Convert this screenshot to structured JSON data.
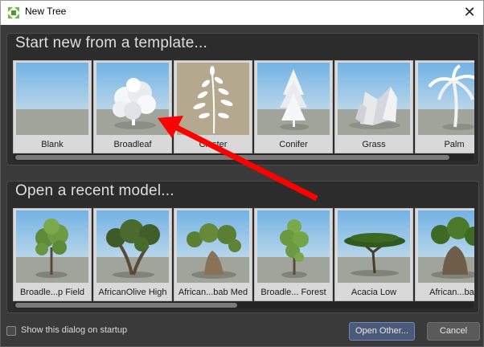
{
  "window": {
    "title": "New Tree",
    "close_glyph": "✕",
    "icon": "app-tree-icon"
  },
  "templates": {
    "heading": "Start new from a template...",
    "items": [
      {
        "label": "Blank",
        "icon": "blank-thumbnail"
      },
      {
        "label": "Broadleaf",
        "icon": "broadleaf-thumbnail"
      },
      {
        "label": "Cluster",
        "icon": "cluster-thumbnail"
      },
      {
        "label": "Conifer",
        "icon": "conifer-thumbnail"
      },
      {
        "label": "Grass",
        "icon": "grass-thumbnail"
      },
      {
        "label": "Palm",
        "icon": "palm-thumbnail"
      }
    ],
    "scroll_position": 0.0
  },
  "recent": {
    "heading": "Open a recent model...",
    "items": [
      {
        "label": "Broadle...p Field",
        "icon": "tree-thumbnail"
      },
      {
        "label": "AfricanOlive High",
        "icon": "tree-thumbnail"
      },
      {
        "label": "African...bab Med",
        "icon": "tree-thumbnail"
      },
      {
        "label": "Broadle... Forest",
        "icon": "tree-thumbnail"
      },
      {
        "label": "Acacia Low",
        "icon": "tree-thumbnail"
      },
      {
        "label": "African...bab",
        "icon": "tree-thumbnail"
      }
    ],
    "scroll_position": 0.0
  },
  "footer": {
    "startup_checkbox_label": "Show this dialog on startup",
    "startup_checked": false,
    "open_other_label": "Open Other...",
    "cancel_label": "Cancel"
  },
  "colors": {
    "annotation_arrow": "#ff0000",
    "sky_top": "#7bb8e6",
    "ground": "#a0a49a"
  }
}
